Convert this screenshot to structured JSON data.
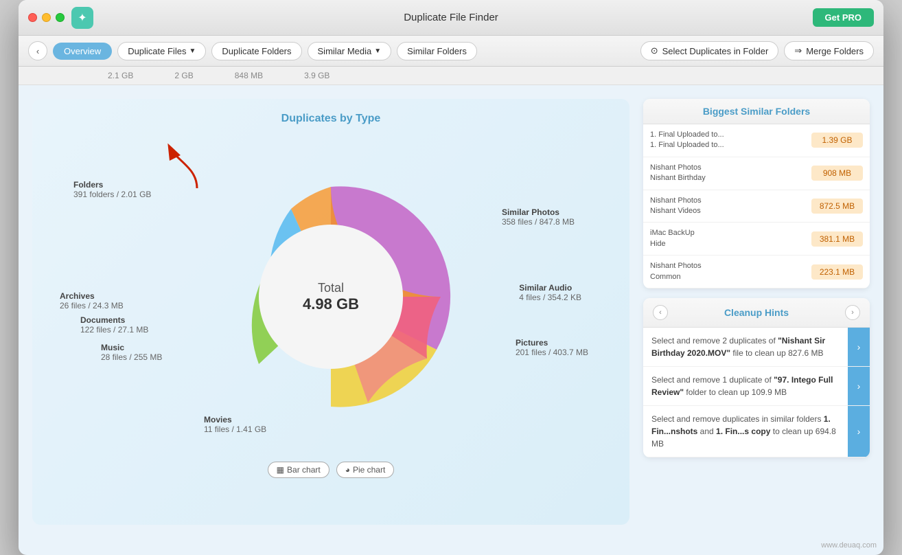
{
  "window": {
    "title": "Duplicate File Finder",
    "get_pro_label": "Get PRO"
  },
  "toolbar": {
    "back_icon": "‹",
    "overview_label": "Overview",
    "nav_items": [
      {
        "label": "Duplicate Files",
        "has_arrow": true
      },
      {
        "label": "Duplicate Folders"
      },
      {
        "label": "Similar Media",
        "has_arrow": true
      },
      {
        "label": "Similar Folders"
      }
    ],
    "special_items": [
      {
        "label": "Select Duplicates in Folder",
        "icon": "⊙"
      },
      {
        "label": "Merge Folders",
        "icon": "⇒"
      }
    ]
  },
  "sub_sizes": [
    "2.1 GB",
    "2 GB",
    "848 MB",
    "3.9 GB"
  ],
  "chart": {
    "title": "Duplicates by Type",
    "total_label": "Total",
    "total_value": "4.98 GB",
    "bar_chart_label": "Bar chart",
    "pie_chart_label": "Pie chart",
    "segments": [
      {
        "name": "Folders",
        "color": "#bf6fc9",
        "value": 0.35
      },
      {
        "name": "Movies",
        "color": "#f5d844",
        "value": 0.2
      },
      {
        "name": "Similar Photos",
        "color": "#f0922c",
        "value": 0.16
      },
      {
        "name": "Similar Audio",
        "color": "#f56c8a",
        "value": 0.04
      },
      {
        "name": "Pictures",
        "color": "#f09080",
        "value": 0.06
      },
      {
        "name": "Music",
        "color": "#5dbcf0",
        "value": 0.04
      },
      {
        "name": "Documents",
        "color": "#88cc44",
        "value": 0.04
      },
      {
        "name": "Archives",
        "color": "#f5a040",
        "value": 0.03
      }
    ],
    "labels": [
      {
        "name": "Folders",
        "sub": "391 folders / 2.01 GB",
        "pos": "top-left"
      },
      {
        "name": "Archives",
        "sub": "26 files / 24.3 MB",
        "pos": "mid-left"
      },
      {
        "name": "Documents",
        "sub": "122 files / 27.1 MB",
        "pos": "lower-left"
      },
      {
        "name": "Music",
        "sub": "28 files / 255 MB",
        "pos": "bottom-left"
      },
      {
        "name": "Movies",
        "sub": "11 files / 1.41 GB",
        "pos": "bottom"
      },
      {
        "name": "Similar Photos",
        "sub": "358 files / 847.8 MB",
        "pos": "top-right"
      },
      {
        "name": "Similar Audio",
        "sub": "4 files / 354.2 KB",
        "pos": "mid-right"
      },
      {
        "name": "Pictures",
        "sub": "201 files / 403.7 MB",
        "pos": "lower-right"
      }
    ]
  },
  "biggest_folders": {
    "title": "Biggest Similar Folders",
    "rows": [
      {
        "names": "1. Final Uploaded to...\n1. Final Uploaded to...",
        "size": "1.39 GB"
      },
      {
        "names": "Nishant Photos\nNishant Birthday",
        "size": "908 MB"
      },
      {
        "names": "Nishant Photos\nNishant Videos",
        "size": "872.5 MB"
      },
      {
        "names": "iMac BackUp\nHide",
        "size": "381.1 MB"
      },
      {
        "names": "Nishant Photos\nCommon",
        "size": "223.1 MB"
      }
    ]
  },
  "cleanup_hints": {
    "title": "Cleanup Hints",
    "items": [
      {
        "text": "Select and remove 2 duplicates of \"Nishant Sir Birthday 2020.MOV\" file to clean up 827.6 MB"
      },
      {
        "text": "Select and remove 1 duplicate of \"97. Intego Full Review\" folder to clean up 109.9 MB"
      },
      {
        "text": "Select and remove duplicates in similar folders 1. Fin...nshots and 1. Fin...s copy to clean up 694.8 MB"
      }
    ]
  },
  "watermark": "www.deuaq.com"
}
